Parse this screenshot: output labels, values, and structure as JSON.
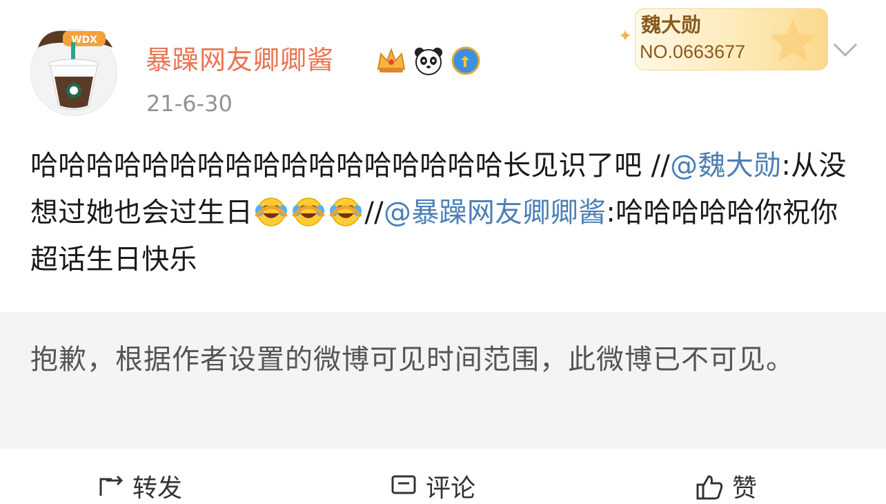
{
  "author": {
    "name": "暴躁网友卿卿酱",
    "avatar_icon": "starbucks-cup-avatar",
    "avatar_badge_text": "WDX",
    "time": "21-6-30",
    "badges": [
      "crown-icon",
      "panda-icon",
      "verified-shield-icon"
    ]
  },
  "fan_card": {
    "name": "魏大勋",
    "number": "NO.0663677"
  },
  "post": {
    "lines": {
      "part1": "哈哈哈哈哈哈哈哈哈哈哈哈哈哈哈哈哈长见识了吧 //",
      "mention1": "@魏大勋",
      "part2": ":从没想过她也会过生日",
      "part3": "//",
      "mention2": "@暴躁网友卿卿酱",
      "part4": ":哈哈哈哈哈你祝你超话生日快乐"
    },
    "emoji": "laughing-crying-emoji"
  },
  "notice": "抱歉，根据作者设置的微博可见时间范围，此微博已不可见。",
  "actions": {
    "repost": "转发",
    "comment": "评论",
    "like": "赞"
  },
  "colors": {
    "username": "#eb7350",
    "mention": "#4a7fb5",
    "notice_bg": "#f4f4f4",
    "time": "#939393"
  }
}
